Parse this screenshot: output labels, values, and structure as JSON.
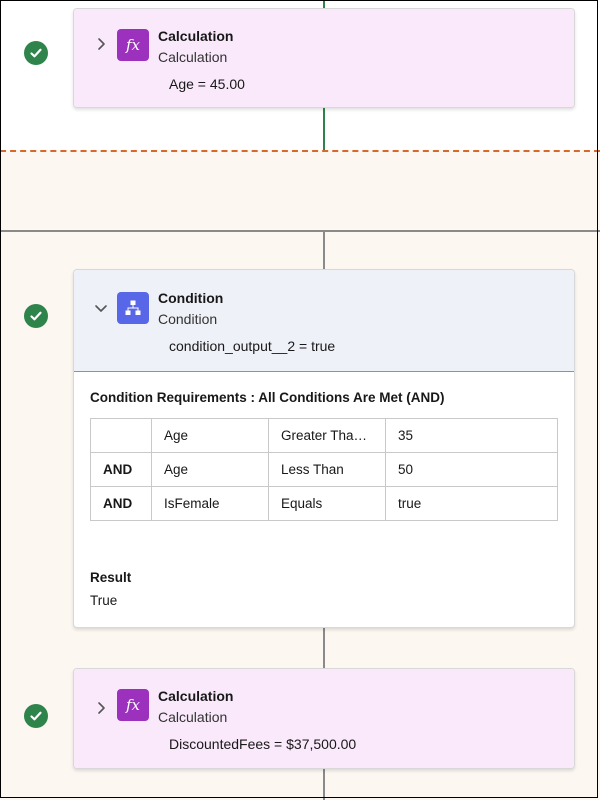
{
  "steps": [
    {
      "title": "Calculation",
      "subtitle": "Calculation",
      "output": "Age = 45.00",
      "icon": "fx-icon",
      "status": "completed"
    },
    {
      "title": "Condition",
      "subtitle": "Condition",
      "output": "condition_output__2 = true",
      "icon": "decision-icon",
      "status": "completed",
      "requirements_title": "Condition Requirements : All Conditions Are Met (AND)",
      "rows": [
        {
          "operator": "",
          "field": "Age",
          "comparison": "Greater Than Or Equal",
          "value": "35"
        },
        {
          "operator": "AND",
          "field": "Age",
          "comparison": "Less Than",
          "value": "50"
        },
        {
          "operator": "AND",
          "field": "IsFemale",
          "comparison": "Equals",
          "value": "true"
        }
      ],
      "result_label": "Result",
      "result_value": "True"
    },
    {
      "title": "Calculation",
      "subtitle": "Calculation",
      "output": "DiscountedFees = $37,500.00",
      "icon": "fx-icon",
      "status": "completed"
    }
  ],
  "colors": {
    "success": "#2e844a",
    "calc_bg": "#f9e9fb",
    "calc_icon": "#9b31bd",
    "condition_bg": "#eef1f8",
    "condition_icon": "#5867e8",
    "divider_dash": "#d9692b"
  }
}
